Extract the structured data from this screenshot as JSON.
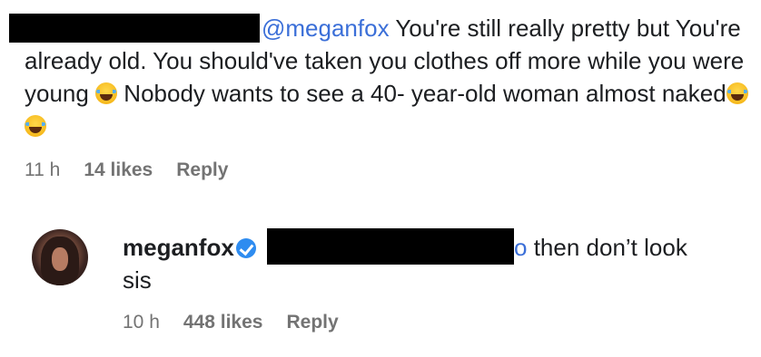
{
  "comment": {
    "mention": "@meganfox",
    "text_part1": " You're still really pretty but You're already old. You should've taken you clothes off more while you were young",
    "text_part2": " Nobody wants to see a 40- year-old woman almost naked",
    "emoji": "face-with-tears-of-joy",
    "time": "11 h",
    "likes": "14 likes",
    "reply_label": "Reply"
  },
  "reply": {
    "username": "meganfox",
    "text_visible_fragment": "o",
    "text_rest": " then don’t look",
    "text_line2": "sis",
    "time": "10 h",
    "likes": "448 likes",
    "reply_label": "Reply"
  },
  "colors": {
    "mention": "#3b6fd8",
    "meta": "#737373",
    "verified": "#2e8cf0"
  }
}
